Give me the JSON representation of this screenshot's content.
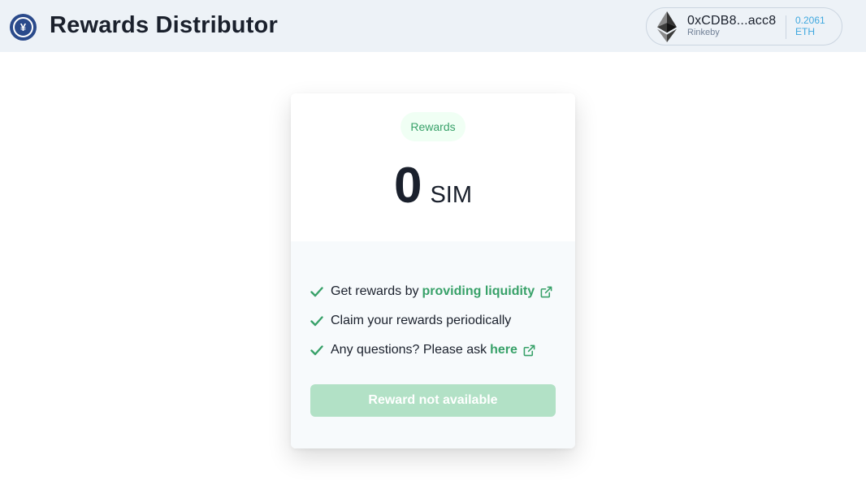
{
  "header": {
    "logo_icon": "yen-coin-logo-icon",
    "logo_glyph": "¥",
    "title": "Rewards Distributor"
  },
  "account": {
    "icon": "ethereum-icon",
    "address": "0xCDB8...acc8",
    "network": "Rinkeby",
    "balance_value": "0.2061",
    "balance_unit": "ETH"
  },
  "card": {
    "badge": "Rewards",
    "amount": "0",
    "unit": "SIM",
    "info": [
      {
        "icon": "check-icon",
        "text": "Get rewards by",
        "link": "providing liquidity",
        "link_icon": "external-link-icon"
      },
      {
        "icon": "check-icon",
        "text": "Claim your rewards periodically"
      },
      {
        "icon": "check-icon",
        "text": "Any questions? Please ask",
        "link": "here",
        "link_icon": "external-link-icon"
      }
    ],
    "button_label": "Reward not available",
    "button_disabled": true
  },
  "colors": {
    "header_bg": "#edf2f7",
    "accent_green": "#38a169",
    "badge_bg": "#f0fff4",
    "disabled_button": "#b2e1c6",
    "balance_blue": "#3fa8df",
    "logo_blue": "#2a4a8b"
  }
}
